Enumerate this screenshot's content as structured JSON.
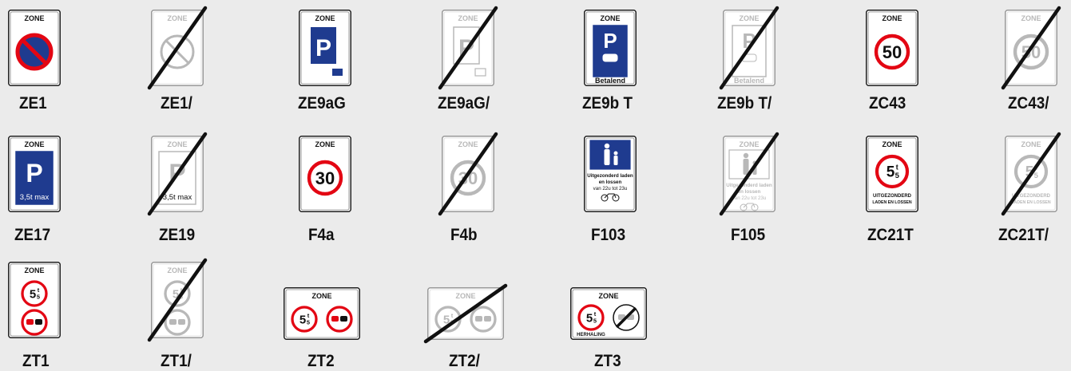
{
  "colors": {
    "background": "#ebebeb",
    "red": "#e30613",
    "blue": "#1f3b8f",
    "black": "#111111",
    "faded": "#b8b8b8"
  },
  "signs": [
    {
      "code": "ZE1",
      "zone": "ZONE",
      "icon": "no-parking-icon",
      "crossed": false
    },
    {
      "code": "ZE1/",
      "zone": "ZONE",
      "icon": "no-parking-icon",
      "crossed": true
    },
    {
      "code": "ZE9aG",
      "zone": "ZONE",
      "icon": "parking-camper-icon",
      "letter": "P",
      "crossed": false
    },
    {
      "code": "ZE9aG/",
      "zone": "ZONE",
      "icon": "parking-camper-icon",
      "letter": "P",
      "crossed": true
    },
    {
      "code": "ZE9b T",
      "zone": "ZONE",
      "icon": "paid-parking-icon",
      "letter": "P",
      "caption": "Betalend",
      "crossed": false
    },
    {
      "code": "ZE9b T/",
      "zone": "ZONE",
      "icon": "paid-parking-icon",
      "letter": "P",
      "caption": "Betalend",
      "crossed": true
    },
    {
      "code": "ZC43",
      "zone": "ZONE",
      "icon": "speed-limit-icon",
      "number": "50",
      "crossed": false
    },
    {
      "code": "ZC43/",
      "zone": "ZONE",
      "icon": "speed-limit-icon",
      "number": "50",
      "crossed": true
    },
    {
      "code": "ZE17",
      "zone": "ZONE",
      "icon": "parking-weight-icon",
      "letter": "P",
      "caption": "3,5t max",
      "crossed": false
    },
    {
      "code": "ZE19",
      "zone": "ZONE",
      "icon": "parking-weight-icon",
      "letter": "P",
      "caption": "3,5t max",
      "crossed": true
    },
    {
      "code": "F4a",
      "zone": "ZONE",
      "icon": "speed-limit-icon",
      "number": "30",
      "crossed": false
    },
    {
      "code": "F4b",
      "zone": "ZONE",
      "icon": "speed-limit-icon",
      "number": "30",
      "crossed": true
    },
    {
      "code": "F103",
      "icon": "pedestrian-zone-icon",
      "caption_lines": [
        "Uitgezonderd laden",
        "en lossen",
        "van 22u tot 23u"
      ],
      "crossed": false
    },
    {
      "code": "F105",
      "zone": "ZONE",
      "icon": "pedestrian-zone-icon",
      "caption_lines": [
        "Uitgezonderd laden",
        "en lossen",
        "van 22u tot 23u"
      ],
      "crossed": true
    },
    {
      "code": "ZC21T",
      "zone": "ZONE",
      "icon": "weight-limit-icon",
      "number": "5",
      "sup": "t",
      "sub": "5",
      "caption_lines": [
        "UITGEZONDERD",
        "LADEN EN LOSSEN"
      ],
      "crossed": false
    },
    {
      "code": "ZC21T/",
      "zone": "ZONE",
      "icon": "weight-limit-icon",
      "number": "5",
      "sup": "t",
      "sub": "5",
      "caption_lines": [
        "UITGEZONDERD",
        "LADEN EN LOSSEN"
      ],
      "crossed": true
    },
    {
      "code": "ZT1",
      "zone": "ZONE",
      "icon": "weight-limit-no-overtaking-icon",
      "number": "5",
      "sup": "t",
      "sub": "5",
      "crossed": false
    },
    {
      "code": "ZT1/",
      "zone": "ZONE",
      "icon": "weight-limit-no-overtaking-icon",
      "number": "5",
      "sup": "t",
      "sub": "5",
      "crossed": true
    },
    {
      "code": "ZT2",
      "zone": "ZONE",
      "icon": "weight-limit-no-overtaking-icon",
      "number": "5",
      "sup": "t",
      "sub": "5",
      "crossed": false
    },
    {
      "code": "ZT2/",
      "zone": "ZONE",
      "icon": "weight-limit-no-overtaking-icon",
      "number": "5",
      "sup": "t",
      "sub": "5",
      "crossed": true
    },
    {
      "code": "ZT3",
      "zone": "ZONE",
      "icon": "weight-limit-end-overtaking-icon",
      "number": "5",
      "sup": "t",
      "sub": "5",
      "caption": "HERHALING",
      "crossed": false
    }
  ]
}
